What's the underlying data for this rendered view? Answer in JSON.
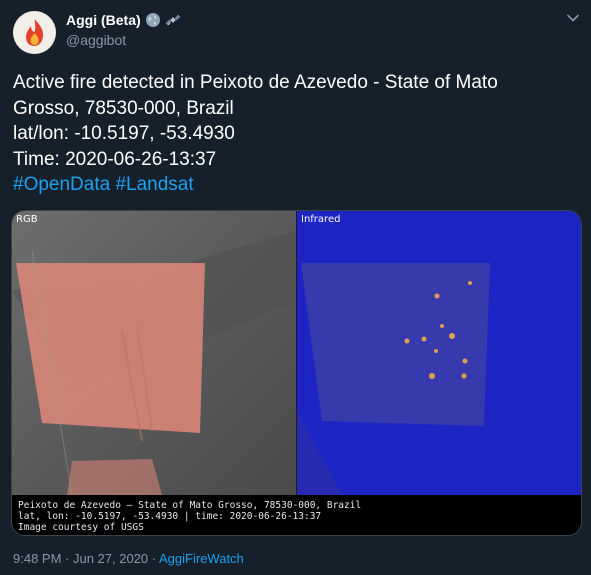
{
  "author": {
    "display_name": "Aggi (Beta)",
    "handle": "@aggibot",
    "badges": [
      "globe-emoji",
      "satellite-emoji"
    ]
  },
  "tweet": {
    "line1": "Active fire detected in Peixoto de Azevedo - State of Mato",
    "line2": "Grosso, 78530-000, Brazil",
    "line3": "lat/lon: -10.5197, -53.4930",
    "line4": "Time: 2020-06-26-13:37",
    "hashtag1": "#OpenData",
    "hashtag2": "#Landsat"
  },
  "media": {
    "left_label": "RGB",
    "right_label": "Infrared",
    "caption_line1": "Peixoto de Azevedo — State of Mato Grosso, 78530-000, Brazil",
    "caption_line2": "lat, lon: -10.5197, -53.4930 | time: 2020-06-26-13:37",
    "caption_line3": "Image courtesy of USGS"
  },
  "footer": {
    "time": "9:48 PM",
    "separator": " · ",
    "date": "Jun 27, 2020",
    "source": "AggiFireWatch"
  },
  "colors": {
    "background": "#15202b",
    "text": "#ffffff",
    "secondary": "#8899a6",
    "link": "#1da1f2",
    "rgb_field": "#e0887a",
    "infrared_bg": "#1d24c4"
  }
}
